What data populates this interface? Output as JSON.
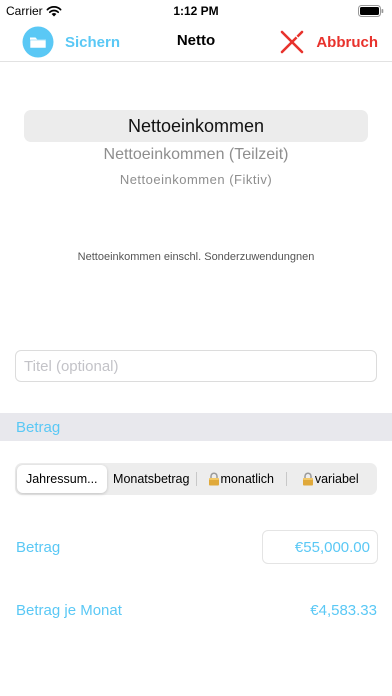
{
  "status_bar": {
    "carrier": "Carrier",
    "time": "1:12 PM"
  },
  "nav": {
    "save_label": "Sichern",
    "title": "Netto",
    "cancel_label": "Abbruch",
    "save_icon": "folder-icon",
    "cancel_icon": "cancel-icon"
  },
  "picker": {
    "selected": "Nettoeinkommen",
    "options": [
      "Nettoeinkommen (Teilzeit)",
      "Nettoeinkommen (Fiktiv)"
    ]
  },
  "description": "Nettoeinkommen einschl. Sonderzuwendungnen",
  "title_field": {
    "placeholder": "Titel (optional)",
    "value": ""
  },
  "section": {
    "header": "Betrag"
  },
  "segmented": {
    "segments": [
      {
        "label": "Jahressum...",
        "locked": false,
        "selected": true
      },
      {
        "label": "Monatsbetrag",
        "locked": false,
        "selected": false
      },
      {
        "label": "monatlich",
        "locked": true,
        "selected": false
      },
      {
        "label": "variabel",
        "locked": true,
        "selected": false
      }
    ]
  },
  "betrag": {
    "label": "Betrag",
    "value": "€55,000.00"
  },
  "betrag_monat": {
    "label": "Betrag je Monat",
    "value": "€4,583.33"
  },
  "colors": {
    "accent": "#5ac8f5",
    "cancel": "#e8322c",
    "section_bg": "#e8e8ed"
  }
}
